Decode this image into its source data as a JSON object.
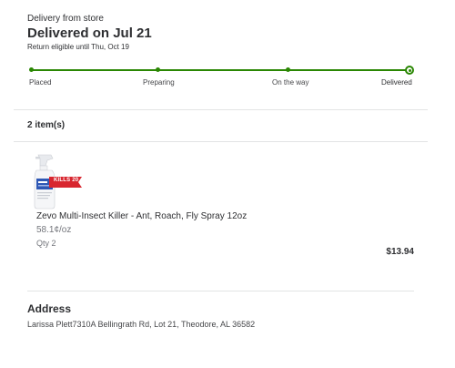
{
  "order": {
    "delivery_type": "Delivery from store",
    "status_title": "Delivered on Jul 21",
    "return_note": "Return eligible until Thu, Oct 19"
  },
  "progress": {
    "steps": [
      "Placed",
      "Preparing",
      "On the way",
      "Delivered"
    ],
    "current_step": "Delivered",
    "accent_color": "#2a8703"
  },
  "items": {
    "count_label": "2 item(s)",
    "list": [
      {
        "name": "Zevo Multi-Insect Killer - Ant, Roach, Fly Spray 12oz",
        "unit_price": "58.1¢/oz",
        "qty": "Qty 2",
        "price": "$13.94",
        "image_badge": "KILLS 20"
      }
    ]
  },
  "address": {
    "heading": "Address",
    "text": "Larissa Plett7310A Bellingrath Rd, Lot 21, Theodore, AL 36582"
  }
}
